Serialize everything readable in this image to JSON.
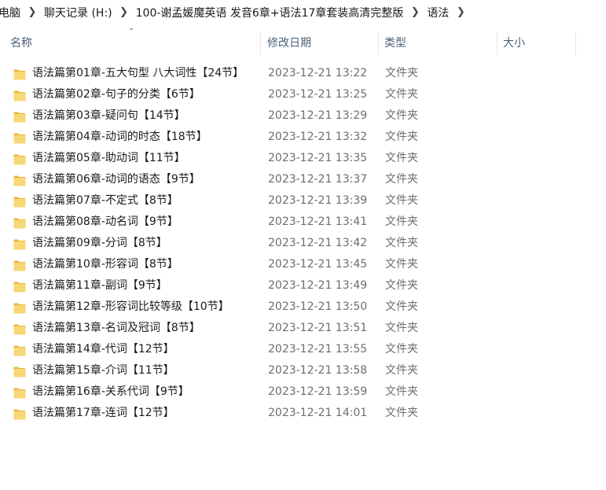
{
  "breadcrumb": [
    "电脑",
    "聊天记录 (H:)",
    "100-谢孟媛魔英语 发音6章+语法17章套装高清完整版",
    "语法"
  ],
  "columns": {
    "name": "名称",
    "modified": "修改日期",
    "type": "类型",
    "size": "大小"
  },
  "icons": {
    "folder": "folder-icon",
    "separator": "chevron-right-icon",
    "sort": "sort-ascending-icon"
  },
  "colors": {
    "folder_body": "#f8d775",
    "folder_tab": "#e8b73c",
    "header_text": "#4c607a",
    "secondary_text": "#6d6d6d"
  },
  "files": [
    {
      "name": "语法篇第01章-五大句型 八大词性【24节】",
      "modified": "2023-12-21 13:22",
      "type": "文件夹"
    },
    {
      "name": "语法篇第02章-句子的分类【6节】",
      "modified": "2023-12-21 13:25",
      "type": "文件夹"
    },
    {
      "name": "语法篇第03章-疑问句【14节】",
      "modified": "2023-12-21 13:29",
      "type": "文件夹"
    },
    {
      "name": "语法篇第04章-动词的时态【18节】",
      "modified": "2023-12-21 13:32",
      "type": "文件夹"
    },
    {
      "name": "语法篇第05章-助动词【11节】",
      "modified": "2023-12-21 13:35",
      "type": "文件夹"
    },
    {
      "name": "语法篇第06章-动词的语态【9节】",
      "modified": "2023-12-21 13:37",
      "type": "文件夹"
    },
    {
      "name": "语法篇第07章-不定式【8节】",
      "modified": "2023-12-21 13:39",
      "type": "文件夹"
    },
    {
      "name": "语法篇第08章-动名词【9节】",
      "modified": "2023-12-21 13:41",
      "type": "文件夹"
    },
    {
      "name": "语法篇第09章-分词【8节】",
      "modified": "2023-12-21 13:42",
      "type": "文件夹"
    },
    {
      "name": "语法篇第10章-形容词【8节】",
      "modified": "2023-12-21 13:45",
      "type": "文件夹"
    },
    {
      "name": "语法篇第11章-副词【9节】",
      "modified": "2023-12-21 13:49",
      "type": "文件夹"
    },
    {
      "name": "语法篇第12章-形容词比较等级【10节】",
      "modified": "2023-12-21 13:50",
      "type": "文件夹"
    },
    {
      "name": "语法篇第13章-名词及冠词【8节】",
      "modified": "2023-12-21 13:51",
      "type": "文件夹"
    },
    {
      "name": "语法篇第14章-代词【12节】",
      "modified": "2023-12-21 13:55",
      "type": "文件夹"
    },
    {
      "name": "语法篇第15章-介词【11节】",
      "modified": "2023-12-21 13:58",
      "type": "文件夹"
    },
    {
      "name": "语法篇第16章-关系代词【9节】",
      "modified": "2023-12-21 13:59",
      "type": "文件夹"
    },
    {
      "name": "语法篇第17章-连词【12节】",
      "modified": "2023-12-21 14:01",
      "type": "文件夹"
    }
  ]
}
